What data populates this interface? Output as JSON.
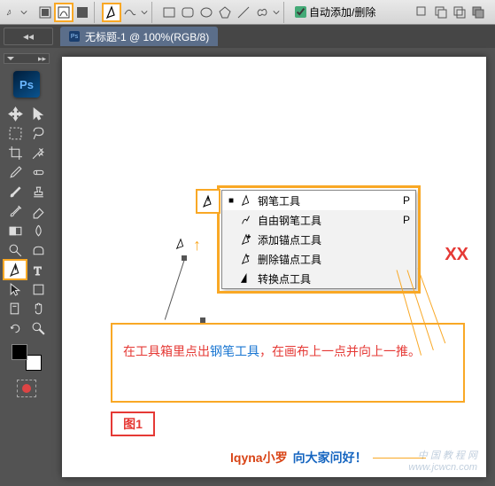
{
  "options_bar": {
    "auto_add_delete_label": "自动添加/删除",
    "auto_add_delete_checked": true
  },
  "document": {
    "title_label": "无标题-1 @ 100%(RGB/8)",
    "ps_badge": "Ps"
  },
  "toolbox": {
    "ps_logo": "Ps"
  },
  "flyout": {
    "items": [
      {
        "label": "钢笔工具",
        "key": "P",
        "active": true
      },
      {
        "label": "自由钢笔工具",
        "key": "P",
        "active": false
      },
      {
        "label": "添加锚点工具",
        "key": "",
        "active": false
      },
      {
        "label": "删除锚点工具",
        "key": "",
        "active": false
      },
      {
        "label": "转换点工具",
        "key": "",
        "active": false
      }
    ]
  },
  "xx_mark": "XX",
  "instructions": {
    "part1": "在工具箱里点出",
    "part2_blue": "钢笔工具",
    "part3": "，在画布上一点并向上一推。"
  },
  "figure_label": "图1",
  "signature": {
    "name": "lqyna小罗",
    "greet": "向大家问好！"
  },
  "watermark": {
    "line1": "中 国 教 程 网",
    "line2": "www.jcwcn.com"
  }
}
